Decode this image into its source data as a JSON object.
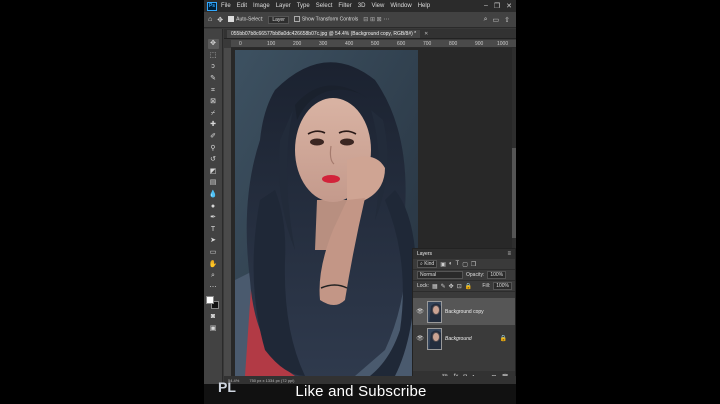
{
  "menubar": {
    "app_icon": "Ps",
    "items": [
      "File",
      "Edit",
      "Image",
      "Layer",
      "Type",
      "Select",
      "Filter",
      "3D",
      "View",
      "Window",
      "Help"
    ]
  },
  "options": {
    "auto_select_label": "Auto-Select:",
    "auto_select_target": "Layer",
    "show_transform_label": "Show Transform Controls"
  },
  "document": {
    "tab_title": "055bb07b8c66577bb8a0dc426658b07c.jpg @ 54.4% (Background copy, RGB/8#) *",
    "ruler_marks": [
      "0",
      "100",
      "200",
      "300",
      "400",
      "500",
      "600",
      "700",
      "800",
      "900",
      "1000"
    ],
    "status": "750 px x 1334 px (72 ppi)",
    "zoom": "54.4%"
  },
  "layers_panel": {
    "title": "Layers",
    "filter_label": "Kind",
    "blend_mode": "Normal",
    "opacity_label": "Opacity:",
    "opacity_value": "100%",
    "lock_label": "Lock:",
    "fill_label": "Fill:",
    "fill_value": "100%",
    "layers": [
      {
        "name": "Background copy",
        "selected": true,
        "locked": false
      },
      {
        "name": "Background",
        "selected": false,
        "locked": true
      }
    ]
  },
  "overlay": {
    "caption": "Like and Subscribe",
    "watermark": "PL"
  },
  "colors": {
    "foreground": "#ffffff",
    "background": "#111111",
    "ps_accent": "#31a8ff"
  }
}
